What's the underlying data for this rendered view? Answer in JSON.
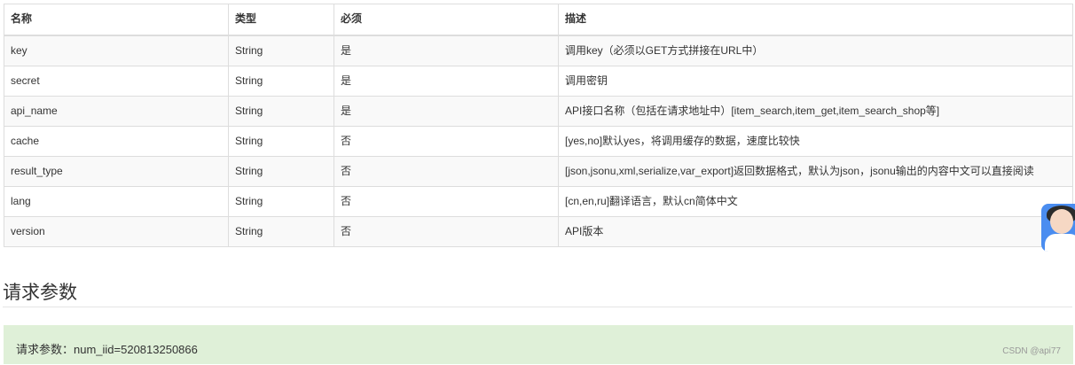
{
  "table": {
    "headers": [
      "名称",
      "类型",
      "必须",
      "描述"
    ],
    "rows": [
      {
        "name": "key",
        "type": "String",
        "required": "是",
        "desc": "调用key（必须以GET方式拼接在URL中）"
      },
      {
        "name": "secret",
        "type": "String",
        "required": "是",
        "desc": "调用密钥"
      },
      {
        "name": "api_name",
        "type": "String",
        "required": "是",
        "desc": "API接口名称（包括在请求地址中）[item_search,item_get,item_search_shop等]"
      },
      {
        "name": "cache",
        "type": "String",
        "required": "否",
        "desc": "[yes,no]默认yes，将调用缓存的数据，速度比较快"
      },
      {
        "name": "result_type",
        "type": "String",
        "required": "否",
        "desc": "[json,jsonu,xml,serialize,var_export]返回数据格式，默认为json，jsonu输出的内容中文可以直接阅读"
      },
      {
        "name": "lang",
        "type": "String",
        "required": "否",
        "desc": "[cn,en,ru]翻译语言，默认cn简体中文"
      },
      {
        "name": "version",
        "type": "String",
        "required": "否",
        "desc": "API版本"
      }
    ]
  },
  "section": {
    "title": "请求参数"
  },
  "request_box": {
    "text": "请求参数：num_iid=520813250866",
    "watermark": "CSDN @api77"
  },
  "float_widget": {
    "icon": "customer-service-avatar-icon"
  }
}
